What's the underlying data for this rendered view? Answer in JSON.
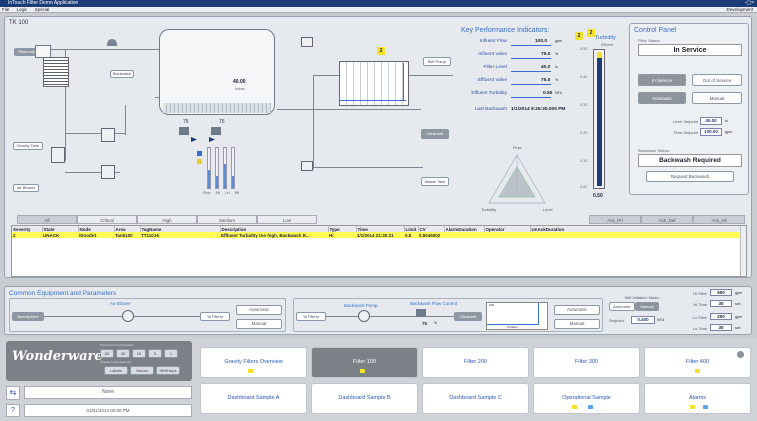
{
  "window": {
    "title": "InTouch Filter Demo Application",
    "controls": "-▢×"
  },
  "menu": {
    "items": [
      "File",
      "Logic",
      "Special"
    ],
    "right": "Development"
  },
  "process": {
    "panel_title": "TK 100",
    "reservoir": "Reservoir",
    "backwash": "Backwash",
    "gravity_tank": "Gravity Tank",
    "air_blower": "Air Blower",
    "bw_pump": "BW Pump",
    "clearwell": "Clearwell",
    "waste_tank": "Waste Tank",
    "tank_level": "40.00",
    "tank_unit": "inches",
    "pct_left": "75",
    "pct_right": "75",
    "pct_unit": "%",
    "badge": "2",
    "bar_labels": [
      "Flow",
      "Eff",
      "Lvl",
      "Eff"
    ]
  },
  "kpi": {
    "title": "Key Performance Indicators:",
    "badge": "2",
    "rows": [
      {
        "label": "Influent Flow",
        "value": "100.0",
        "unit": "gpm"
      },
      {
        "label": "Influent Valve",
        "value": "75.0",
        "unit": "%"
      },
      {
        "label": "Filter Level",
        "value": "40.0",
        "unit": "in"
      },
      {
        "label": "Effluent Valve",
        "value": "75.0",
        "unit": "%"
      },
      {
        "label": "Effluent Turbidity",
        "value": "0.50",
        "unit": "NTU"
      },
      {
        "label": "Last Backwash",
        "value": "1/1/2014 9:26:20.000 PM",
        "unit": ""
      }
    ],
    "radar": {
      "top": "Flow",
      "left": "Turbidity",
      "right": "Level"
    }
  },
  "turbidity": {
    "title": "Turbidity",
    "badge": "2",
    "sublabel": "Effluent",
    "value": "0.50",
    "scale": [
      "0.50",
      "0.40",
      "0.30",
      "0.20",
      "0.10",
      "0.00"
    ]
  },
  "control": {
    "title": "Control Panel",
    "filter_status_label": "Filter Status:",
    "filter_status": "In Service",
    "in_service": "In Service",
    "out_service": "Out of Service",
    "automatic": "Automatic",
    "manual": "Manual",
    "level_sp_label": "Level Setpoint",
    "level_sp": "40.00",
    "level_sp_unit": "in",
    "flow_sp_label": "Flow Setpoint",
    "flow_sp": "100.00",
    "flow_sp_unit": "gpm",
    "bw_status_label": "Backwash Status:",
    "bw_status": "Backwash Required",
    "request_bw": "Request Backwash"
  },
  "alarms": {
    "tabs_left": [
      "All",
      "Critical",
      "High",
      "Medium",
      "Low"
    ],
    "tabs_right": [
      "Ack_Pri",
      "Ack_Del",
      "Ack_All"
    ],
    "columns": [
      "Severity",
      "State",
      "Node",
      "Area",
      "TagName",
      "Description",
      "Type",
      "Time",
      "Limit",
      "CV",
      "AlarmDuration",
      "Operator",
      "UnAckDuration"
    ],
    "rows": [
      [
        "2",
        "UNACK",
        "iDnode1",
        "Tank100",
        "TT110.Hi",
        "Effluent Turbidity too high, Backwash R...",
        "Hi",
        "1/1/2014 21:30:21",
        "0.5",
        "0.5045002",
        "",
        "",
        ""
      ]
    ]
  },
  "common": {
    "title": "Common Equipment and Parameters",
    "air_blower": "Air Blower",
    "atmosphere": "Atmosphere",
    "to_filters": "To Filters",
    "automatic": "Automatic",
    "manual": "Manual",
    "backwash_pump": "Backwash Pump",
    "backwash_flow_control": "Backwash Flow Control",
    "to_filters2": "To Filters",
    "clearwell": "Clearwell",
    "pct": "75",
    "pct_unit": "%",
    "trend_top": "100",
    "trend_bottom": "0 Filters",
    "automatic2": "Automatic",
    "manual2": "Manual",
    "bw_mode_label": "BW Initiation Mode:",
    "bw_auto": "Automatic",
    "bw_manual": "Manual",
    "setpoint_label": "Setpoint",
    "setpoint": "0.400",
    "setpoint_unit": "NTU",
    "hi_filter_label": "Hi Filter",
    "hi_filter": "500",
    "hi_time_label": "Hi Time",
    "hi_time": "30",
    "lo_filter_label": "Lo Filter",
    "lo_filter": "200",
    "lo_time_label": "Lo Time",
    "lo_time": "30",
    "unit_gpm": "gpm",
    "unit_sec": "sec"
  },
  "sidebar": {
    "logo": "Wonderware",
    "alarm_nav_label": "Primary Format Selection",
    "alarm_btns": [
      "60",
      "30",
      "15",
      "5",
      "1"
    ],
    "label_nav": "Graphic Label Selection",
    "label_btns": [
      "Labels",
      "Values",
      "HiHiHops"
    ],
    "user": "None",
    "datetime": "01/01/2014 00:00 PM",
    "help": "?"
  },
  "nav": {
    "buttons": [
      "Gravity Filters Overview",
      "Filter 100",
      "Filter 200",
      "Filter 300",
      "Filter 400",
      "Dashboard Sample A",
      "Dashboard Sample B",
      "Dashboard Sample C",
      "Operational Sample",
      "Alarms"
    ]
  },
  "colors": {
    "accent": "#2a57b5",
    "alarm_row": "#ffff55",
    "badge": "#f5e22c",
    "titlebar": "#1c3c78"
  }
}
